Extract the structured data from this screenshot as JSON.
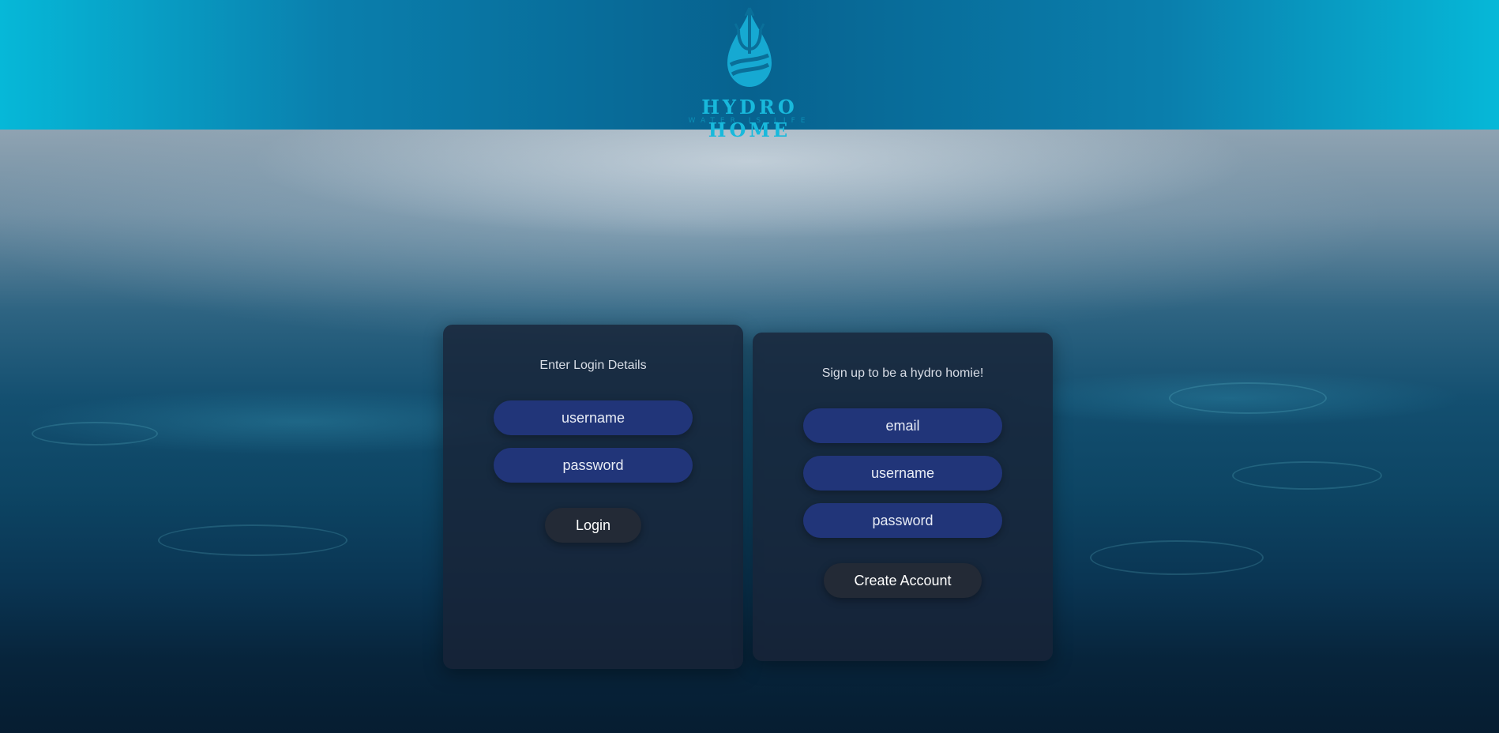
{
  "header": {
    "brand": "HYDRO HOME",
    "tagline": "WATER IS LIFE",
    "logo_icon": "water-drop-trident-icon",
    "colors": {
      "brand": "#18b9dc",
      "header_edge": "#06b8d8",
      "header_center": "#07628f"
    }
  },
  "login": {
    "title": "Enter Login Details",
    "username_placeholder": "username",
    "password_placeholder": "password",
    "button_label": "Login"
  },
  "signup": {
    "title": "Sign up to be a hydro homie!",
    "email_placeholder": "email",
    "username_placeholder": "username",
    "password_placeholder": "password",
    "button_label": "Create Account"
  },
  "colors": {
    "input_bg": "#213579",
    "card_bg": "#192337",
    "button_bg": "#232a36"
  }
}
